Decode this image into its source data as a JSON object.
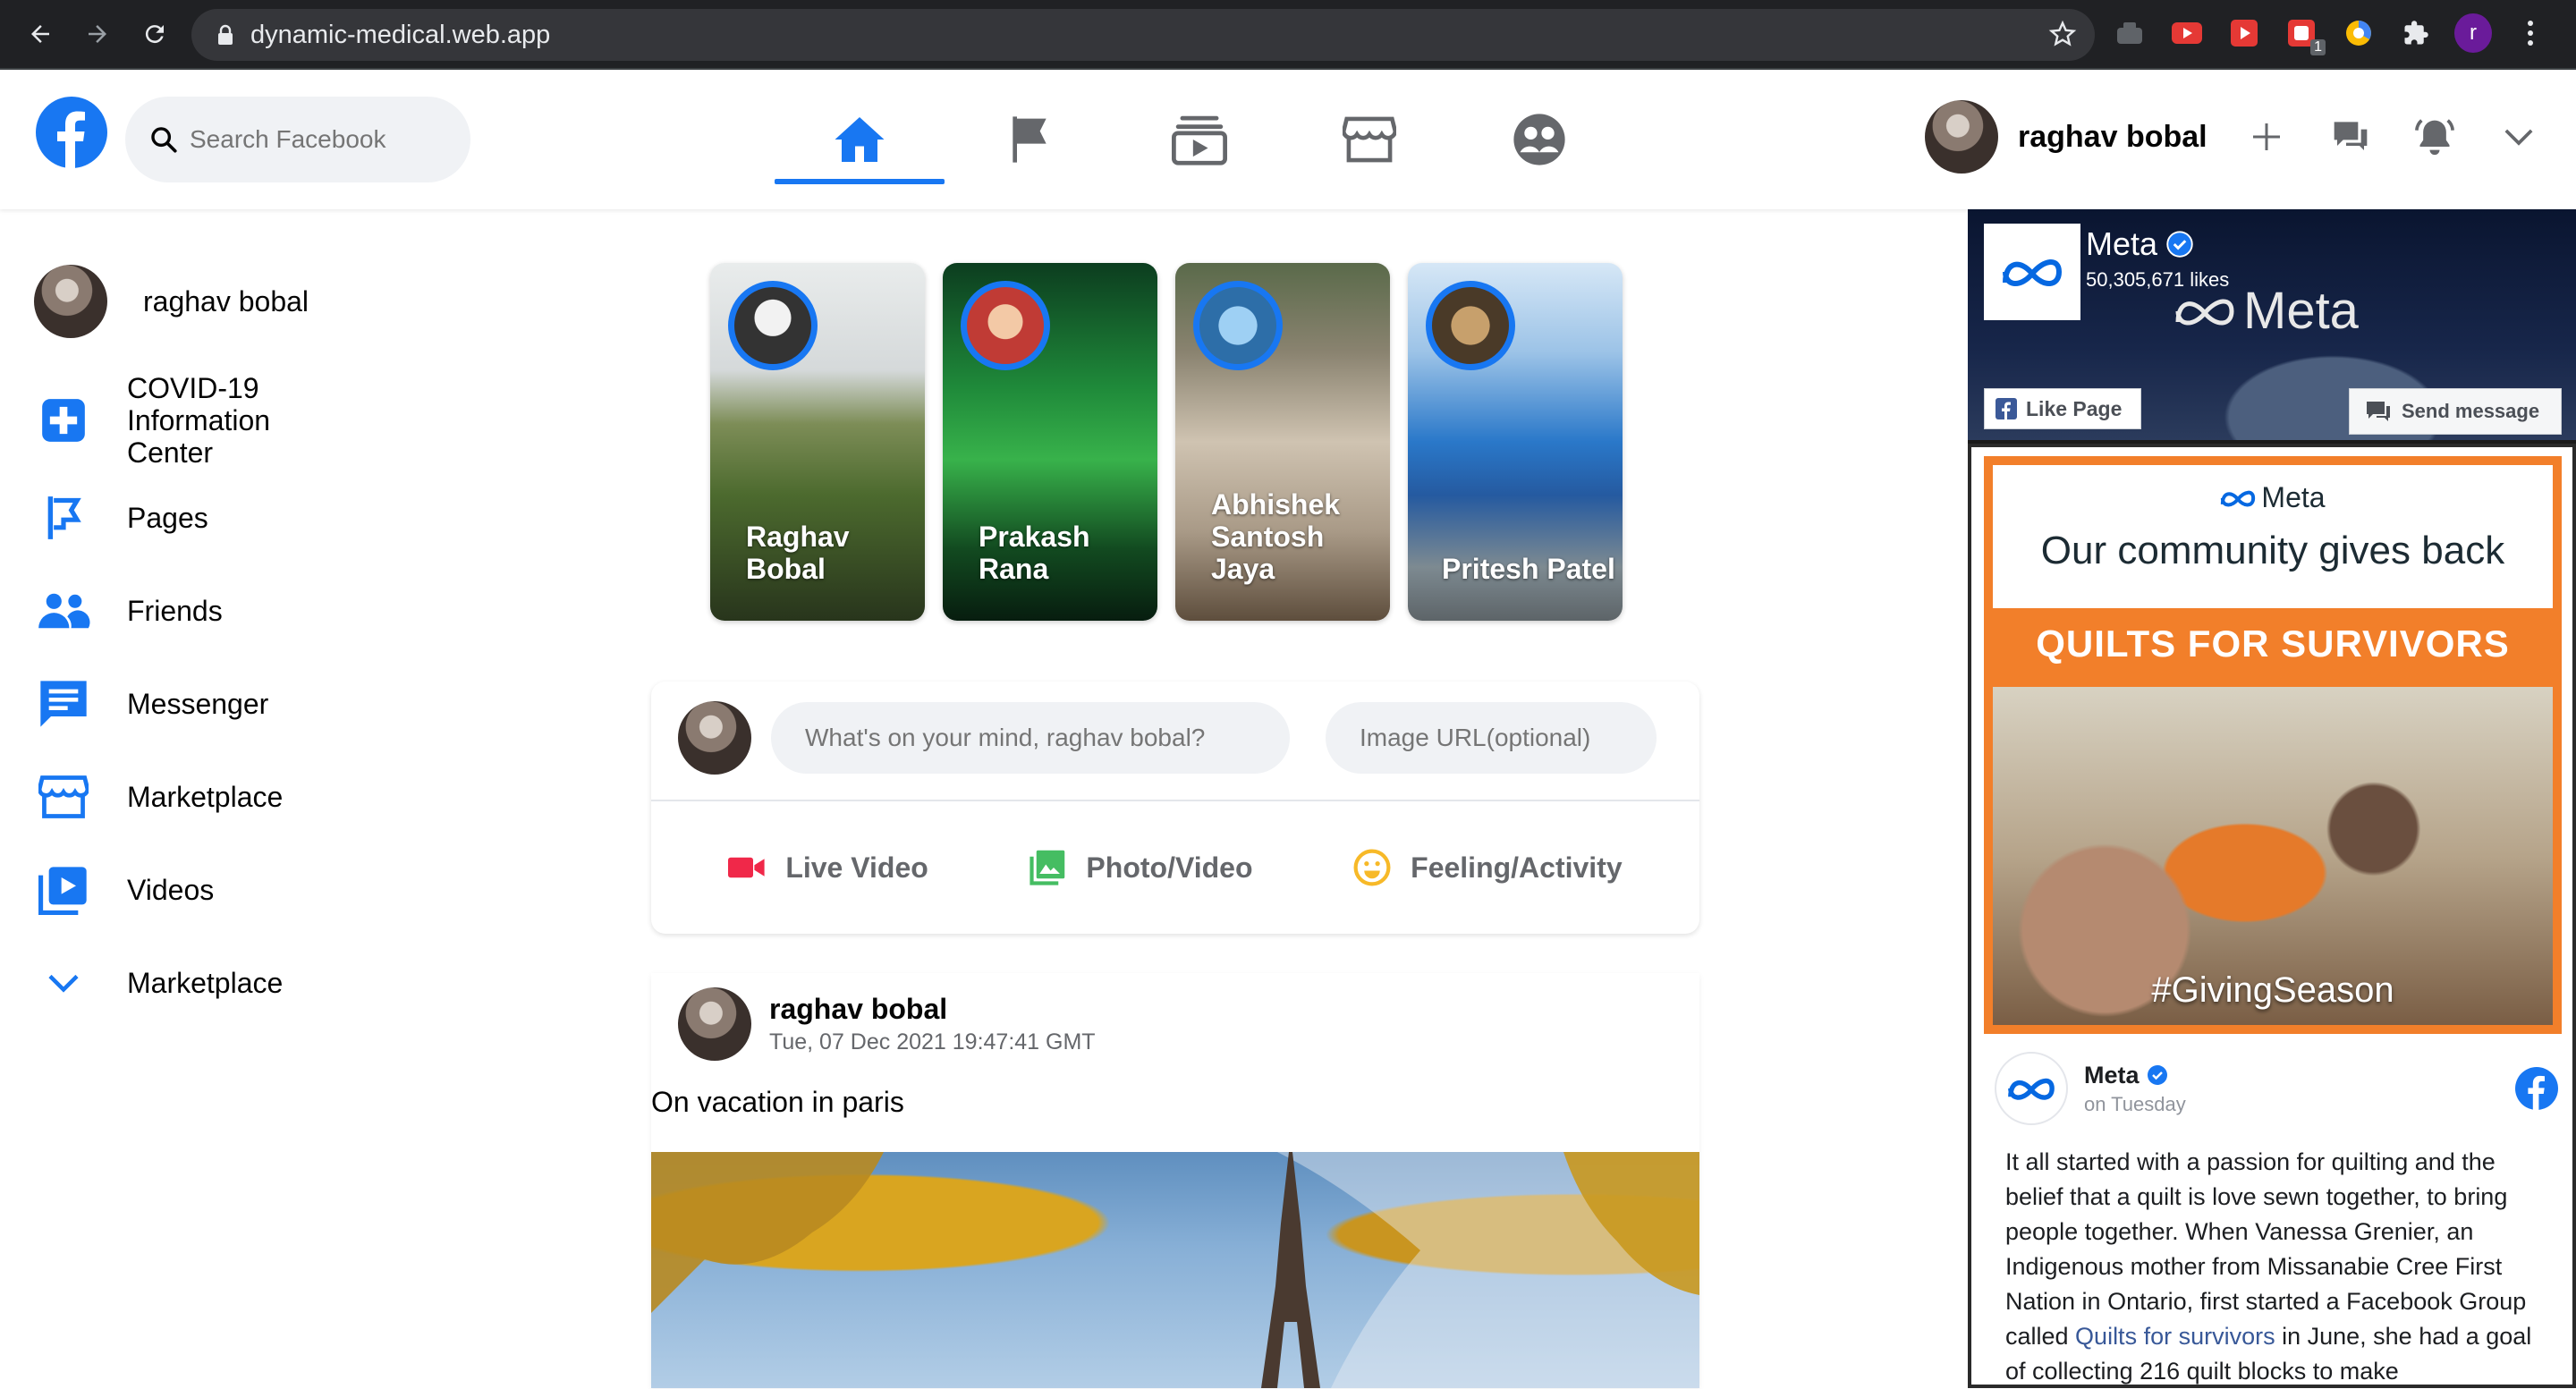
{
  "browser": {
    "url": "dynamic-medical.web.app",
    "ext_badge": "1",
    "profile_initial": "r"
  },
  "header": {
    "search_placeholder": "Search Facebook",
    "user_name": "raghav bobal"
  },
  "sidebar": {
    "user_name": "raghav bobal",
    "items": [
      {
        "label": "COVID-19 Information Center",
        "icon": "covid-info-icon"
      },
      {
        "label": "Pages",
        "icon": "pages-flag-icon"
      },
      {
        "label": "Friends",
        "icon": "friends-icon"
      },
      {
        "label": "Messenger",
        "icon": "messenger-icon"
      },
      {
        "label": "Marketplace",
        "icon": "marketplace-icon"
      },
      {
        "label": "Videos",
        "icon": "videos-icon"
      },
      {
        "label": "Marketplace",
        "icon": "chevron-down-icon"
      }
    ]
  },
  "stories": [
    {
      "name": "Raghav Bobal"
    },
    {
      "name": "Prakash Rana"
    },
    {
      "name": "Abhishek Santosh Jaya"
    },
    {
      "name": "Pritesh Patel"
    }
  ],
  "composer": {
    "post_placeholder": "What's on your mind, raghav bobal?",
    "url_placeholder": "Image URL(optional)",
    "actions": [
      "Live Video",
      "Photo/Video",
      "Feeling/Activity"
    ]
  },
  "post": {
    "author": "raghav bobal",
    "timestamp": "Tue, 07 Dec 2021 19:47:41 GMT",
    "text": "On vacation in paris"
  },
  "meta_widget": {
    "name": "Meta",
    "likes": "50,305,671 likes",
    "banner_text": "Meta",
    "like_button": "Like Page",
    "message_button": "Send message"
  },
  "meta_post": {
    "promo_brand": "Meta",
    "promo_headline": "Our community gives back",
    "promo_subhead": "QUILTS FOR SURVIVORS",
    "promo_tag": "#GivingSeason",
    "author": "Meta",
    "time": "on Tuesday",
    "body_1": "It all started with a passion for quilting and the belief that a quilt is love sewn together, to bring people together. When Vanessa Grenier, an Indigenous mother from Missanabie Cree First Nation in Ontario, first started a Facebook Group called ",
    "body_link": "Quilts for survivors",
    "body_2": " in June, she had a goal of collecting 216 quilt blocks to make"
  },
  "colors": {
    "fb_blue": "#1877f2",
    "live_red": "#f3425f",
    "photo_green": "#45bd62",
    "feeling_yellow": "#f7b928",
    "promo_orange": "#f27f2a"
  }
}
